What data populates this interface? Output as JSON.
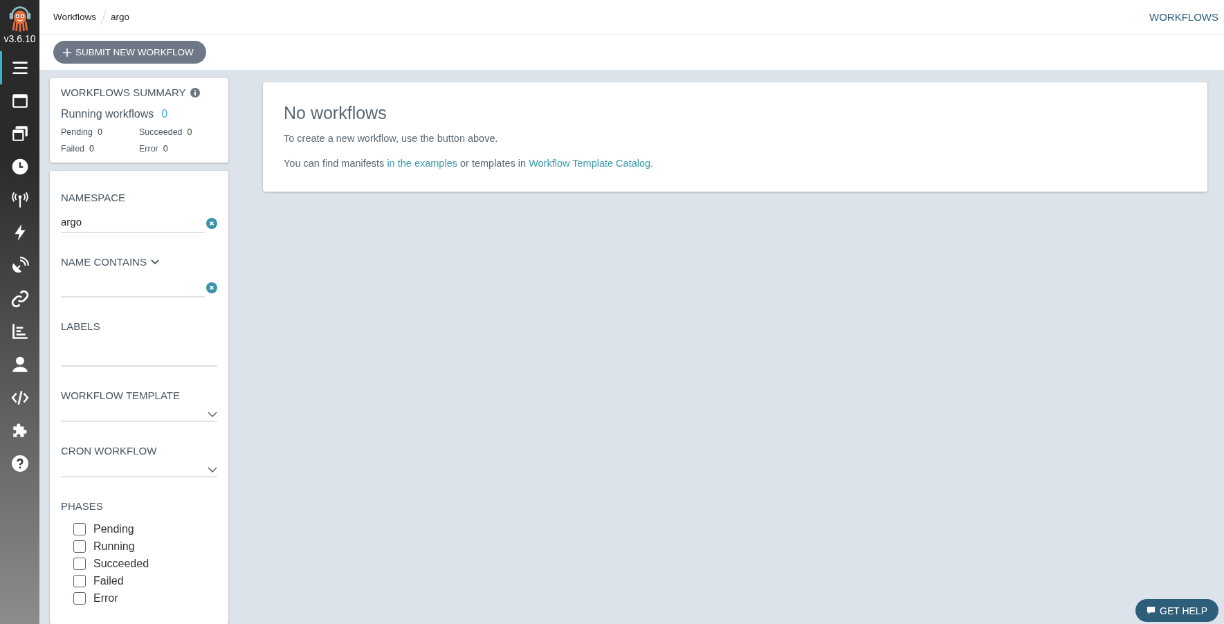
{
  "sidebar": {
    "version": "v3.6.10",
    "items": [
      {
        "kind": "workflows",
        "selected": true
      },
      {
        "kind": "templates",
        "selected": false
      },
      {
        "kind": "cluster-templates",
        "selected": false
      },
      {
        "kind": "cron",
        "selected": false
      },
      {
        "kind": "event-sources",
        "selected": false
      },
      {
        "kind": "sensors",
        "selected": false
      },
      {
        "kind": "event-flow",
        "selected": false
      },
      {
        "kind": "links",
        "selected": false
      },
      {
        "kind": "reports",
        "selected": false
      },
      {
        "kind": "user",
        "selected": false
      },
      {
        "kind": "api",
        "selected": false
      },
      {
        "kind": "plugins",
        "selected": false
      },
      {
        "kind": "help",
        "selected": false
      }
    ]
  },
  "breadcrumbs": {
    "links": [
      "Workflows"
    ],
    "current": "argo"
  },
  "page_title": "WORKFLOWS",
  "toolbar": {
    "submit_button": "SUBMIT NEW WORKFLOW"
  },
  "summary": {
    "title": "WORKFLOWS SUMMARY",
    "running_label": "Running workflows",
    "running_count": "0",
    "stats": [
      {
        "label": "Pending",
        "value": "0"
      },
      {
        "label": "Succeeded",
        "value": "0"
      },
      {
        "label": "Failed",
        "value": "0"
      },
      {
        "label": "Error",
        "value": "0"
      }
    ]
  },
  "filters": [
    {
      "kind": "text",
      "label": "NAMESPACE",
      "value": "argo",
      "clearable": true
    },
    {
      "kind": "text",
      "label": "NAME CONTAINS",
      "dropdown_label": true,
      "clearable": true
    },
    {
      "kind": "tags",
      "label": "LABELS"
    },
    {
      "kind": "select",
      "label": "WORKFLOW TEMPLATE"
    },
    {
      "kind": "select",
      "label": "CRON WORKFLOW"
    }
  ],
  "phases": {
    "label": "PHASES",
    "options": [
      {
        "label": "Pending",
        "checked": false
      },
      {
        "label": "Running",
        "checked": false
      },
      {
        "label": "Succeeded",
        "checked": false
      },
      {
        "label": "Failed",
        "checked": false
      },
      {
        "label": "Error",
        "checked": false
      }
    ]
  },
  "empty_state": {
    "title": "No workflows",
    "text": "To create a new workflow, use the button above.",
    "note": [
      {
        "kind": "text",
        "text": "You can find manifests "
      },
      {
        "kind": "link",
        "text": "in the examples"
      },
      {
        "kind": "text",
        "text": " or templates in "
      },
      {
        "kind": "link",
        "text": "Workflow Template Catalog"
      },
      {
        "kind": "text",
        "text": "."
      }
    ]
  },
  "help_button": "GET HELP"
}
